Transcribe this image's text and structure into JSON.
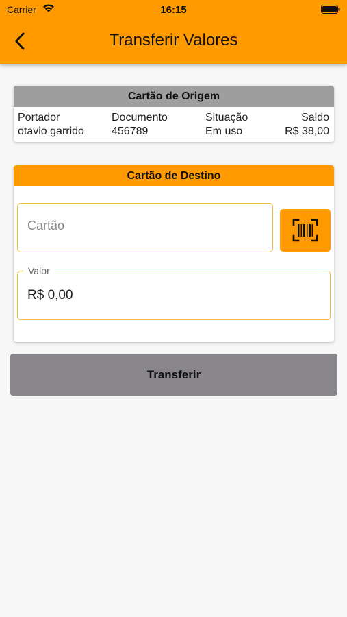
{
  "status_bar": {
    "carrier": "Carrier",
    "time": "16:15"
  },
  "header": {
    "title": "Transferir Valores",
    "color": "#ff9a00"
  },
  "origin_card": {
    "title": "Cartão de Origem",
    "columns": [
      {
        "label": "Portador",
        "value": "otavio garrido"
      },
      {
        "label": "Documento",
        "value": "456789"
      },
      {
        "label": "Situação",
        "value": "Em uso"
      },
      {
        "label": "Saldo",
        "value": "R$ 38,00"
      }
    ]
  },
  "destination_card": {
    "title": "Cartão de Destino",
    "card_field": {
      "placeholder": "Cartão",
      "value": ""
    },
    "value_field": {
      "label": "Valor",
      "value": "R$ 0,00"
    },
    "scan_icon": "barcode-scan-icon"
  },
  "actions": {
    "transfer_label": "Transferir"
  },
  "colors": {
    "accent": "#ff9a00",
    "origin_header": "#9e9e9e",
    "button_disabled": "#89868c",
    "input_border": "#f3b93b"
  }
}
